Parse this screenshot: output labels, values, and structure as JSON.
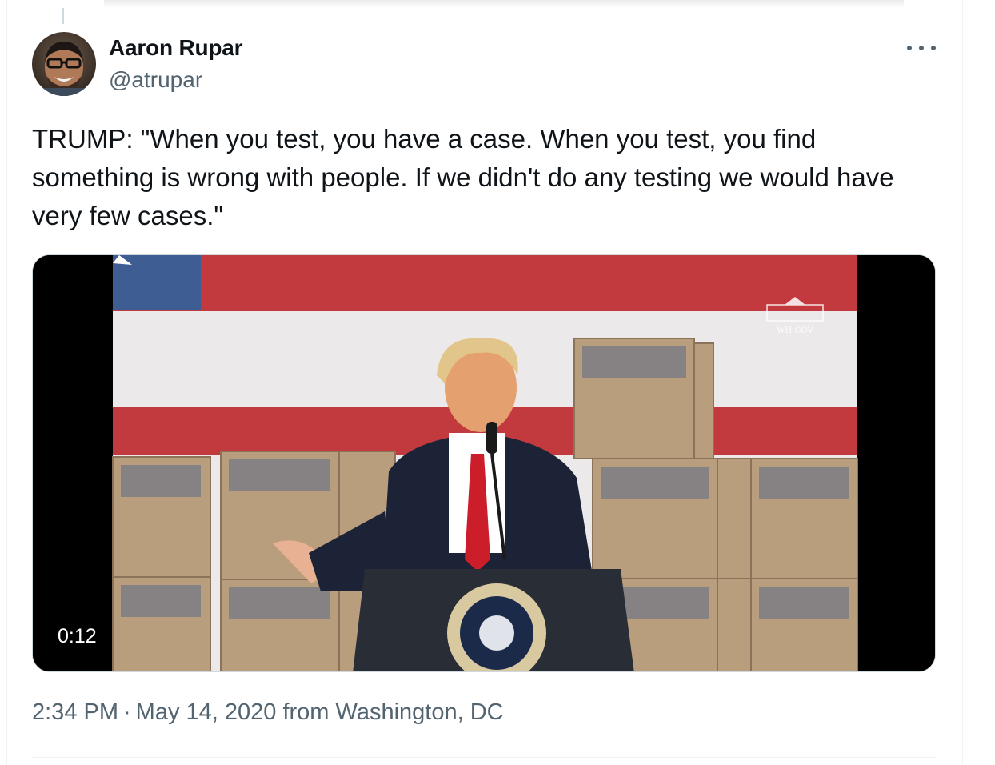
{
  "tweet": {
    "author_name": "Aaron Rupar",
    "author_handle": "@atrupar",
    "text": "TRUMP: \"When you test, you have a case. When you test, you find something is wrong with people. If we didn't do any testing we would have very few cases.\"",
    "media": {
      "duration": "0:12",
      "watermark": "WH.GOV"
    },
    "time": "2:34 PM",
    "separator": "·",
    "date": "May 14, 2020",
    "location": "from Washington, DC"
  },
  "icons": {
    "more": "more-options-icon"
  },
  "colors": {
    "text_primary": "#0f1419",
    "text_secondary": "#536471",
    "divider": "#eff3f4"
  }
}
